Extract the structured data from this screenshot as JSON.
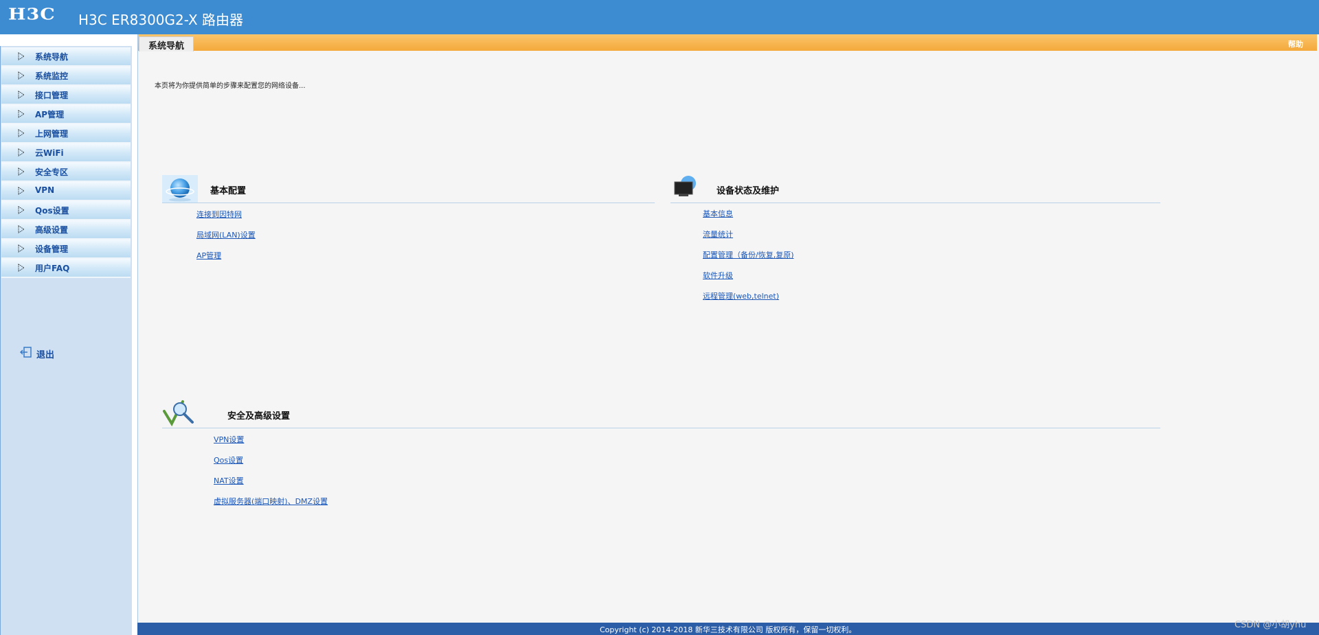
{
  "header": {
    "logo": "H3C",
    "title": "H3C ER8300G2-X 路由器"
  },
  "sidebar": {
    "items": [
      {
        "label": "系统导航"
      },
      {
        "label": "系统监控"
      },
      {
        "label": "接口管理"
      },
      {
        "label": "AP管理"
      },
      {
        "label": "上网管理"
      },
      {
        "label": "云WiFi"
      },
      {
        "label": "安全专区"
      },
      {
        "label": "VPN"
      },
      {
        "label": "Qos设置"
      },
      {
        "label": "高级设置"
      },
      {
        "label": "设备管理"
      },
      {
        "label": "用户FAQ"
      }
    ],
    "logout_label": "退出"
  },
  "tabs": {
    "active_label": "系统导航",
    "help_label": "帮助"
  },
  "main": {
    "intro": "本页将为你提供简单的步骤来配置您的网络设备...",
    "basic": {
      "title": "基本配置",
      "links": [
        "连接到因特网",
        "局域网(LAN)设置",
        "AP管理"
      ]
    },
    "device": {
      "title": "设备状态及维护",
      "links": [
        "基本信息",
        "流量统计",
        "配置管理（备份/恢复,复原)",
        "软件升级",
        "远程管理(web,telnet)"
      ]
    },
    "security": {
      "title": "安全及高级设置",
      "links": [
        "VPN设置",
        "Qos设置",
        "NAT设置",
        "虚拟服务器(端口映射)、DMZ设置"
      ]
    }
  },
  "footer": {
    "copyright": "Copyright (c) 2014-2018 新华三技术有限公司 版权所有，保留一切权利。"
  },
  "watermark": "CSDN @小胡yhu",
  "colors": {
    "header_bg": "#3d8bd0",
    "tab_bar": "#f4a93c",
    "link": "#1a56b8",
    "footer_bg": "#2c5ea8"
  }
}
